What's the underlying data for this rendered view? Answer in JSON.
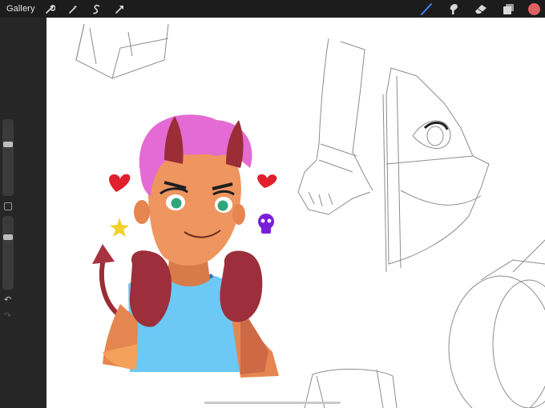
{
  "toolbar": {
    "gallery_label": "Gallery",
    "left_tools": [
      "wrench-icon",
      "magic-wand-icon",
      "selection-icon",
      "transform-arrow-icon"
    ],
    "right_tools": [
      "brush-icon",
      "smudge-icon",
      "eraser-icon",
      "layers-icon"
    ],
    "active_tool": "brush",
    "current_color": "#e06161",
    "active_accent": "#3a86ff"
  },
  "sidebar": {
    "brush_size_level": 0.29,
    "brush_opacity_level": 0.25,
    "undo_icon": "undo-arrow-icon",
    "redo_icon": "redo-arrow-icon"
  }
}
